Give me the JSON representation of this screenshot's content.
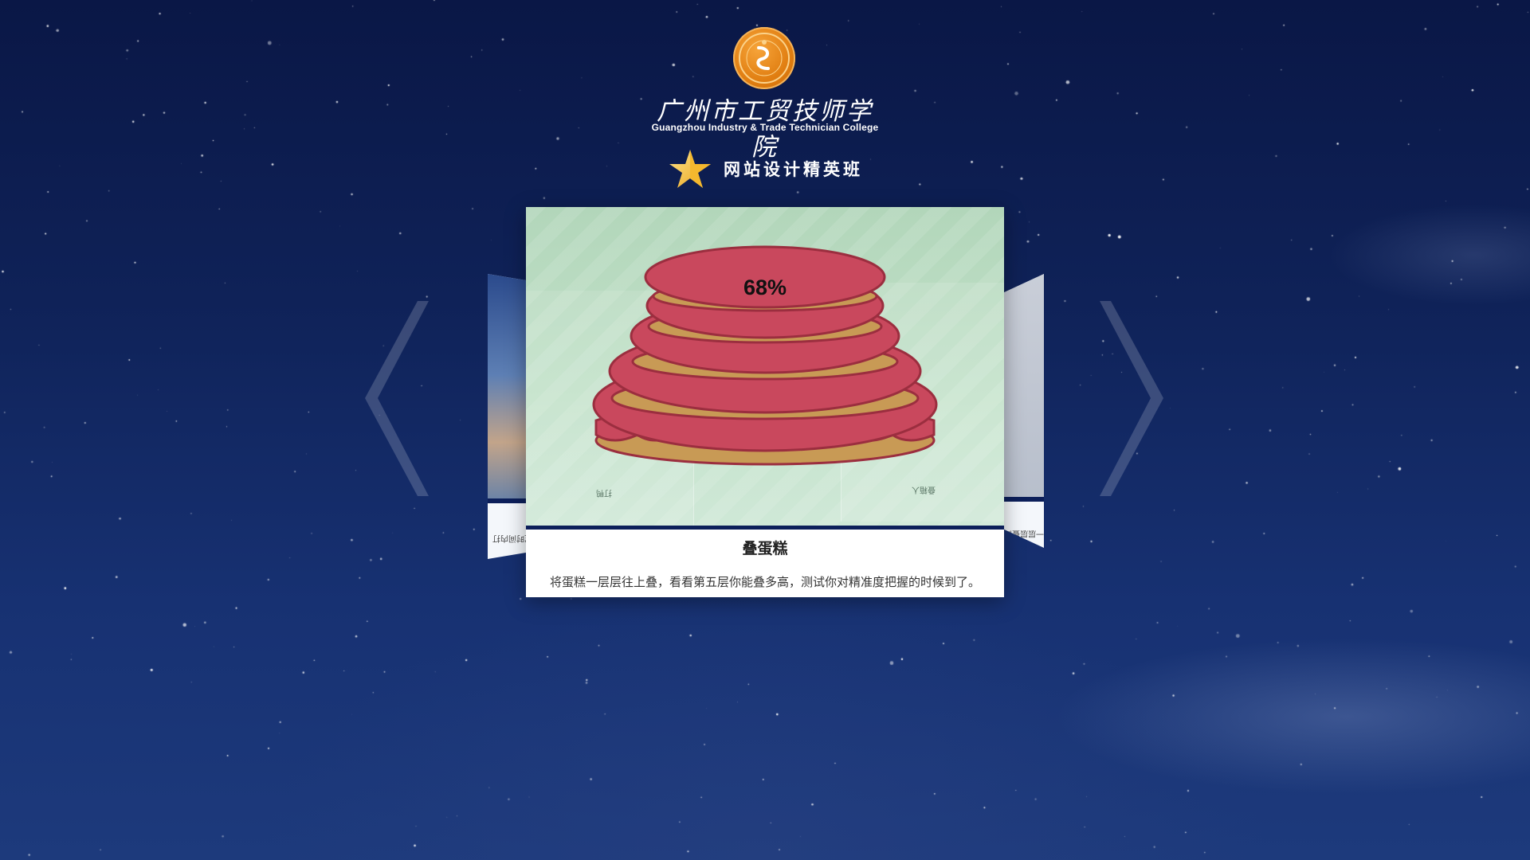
{
  "header": {
    "school_name_cn": "广州市工贸技师学院",
    "school_name_en": "Guangzhou Industry & Trade Technician College",
    "class_title": "网站设计精英班",
    "badge_color": "#e8851a"
  },
  "carousel": {
    "prev_icon": "chevron-left-icon",
    "next_icon": "chevron-right-icon",
    "active": {
      "title": "叠蛋糕",
      "description": "将蛋糕一层层往上叠，看看第五层你能叠多高，测试你对精准度把握的时候到了。",
      "progress_label": "68%",
      "progress": 0.68,
      "ghost_left_title": "打鸭",
      "ghost_right_title": "叠箱人"
    },
    "left_card": {
      "caption": "打鸭，考验你的反应和速度，在规定时间内打"
    },
    "right_card": {
      "caption": "叠箱子，一层层叠高"
    }
  },
  "colors": {
    "background": "#0f2258",
    "band": "#0c1f5a",
    "cake_frosting": "#c9485d",
    "cake_base": "#c89a55"
  }
}
